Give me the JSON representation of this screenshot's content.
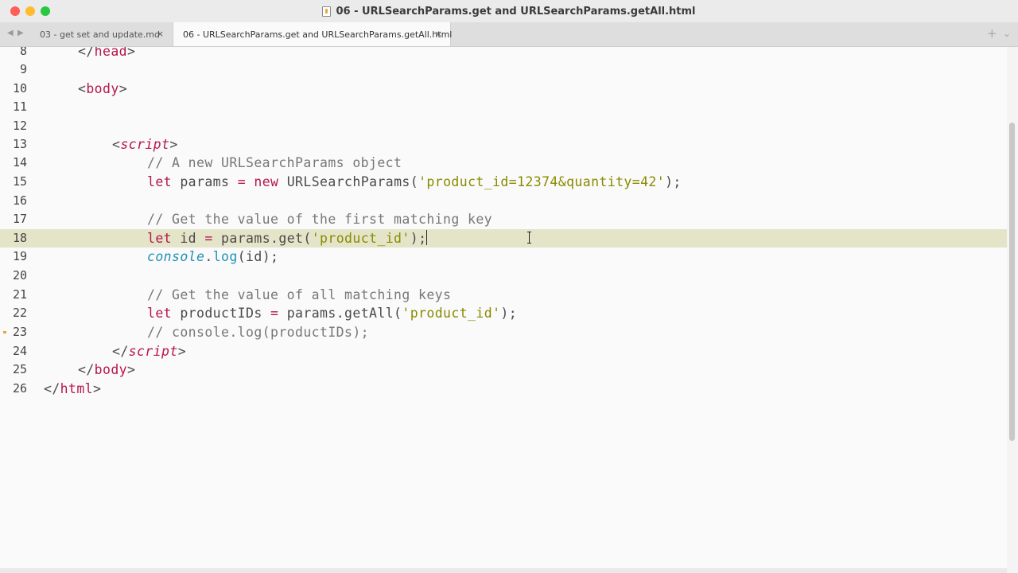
{
  "window": {
    "title": "06 - URLSearchParams.get and URLSearchParams.getAll.html"
  },
  "tabs": [
    {
      "label": "03 - get set and update.md",
      "active": false
    },
    {
      "label": "06 - URLSearchParams.get and URLSearchParams.getAll.html",
      "active": true
    }
  ],
  "icons": {
    "back": "◀",
    "forward": "▶",
    "close": "×",
    "new_tab": "+",
    "tab_overflow": "⌄"
  },
  "editor": {
    "active_line": "18",
    "modified_line": "23",
    "lines": [
      {
        "num": "8",
        "tokens": [
          "</",
          "head",
          ">"
        ]
      },
      {
        "num": "9",
        "tokens": []
      },
      {
        "num": "10",
        "tokens": [
          "<",
          "body",
          ">"
        ]
      },
      {
        "num": "11",
        "tokens": []
      },
      {
        "num": "12",
        "tokens": []
      },
      {
        "num": "13",
        "tokens": [
          "<",
          "script",
          ">"
        ]
      },
      {
        "num": "14",
        "tokens": [
          "// A new URLSearchParams object"
        ]
      },
      {
        "num": "15",
        "tokens": [
          "let",
          " params ",
          "=",
          " ",
          "new",
          " URLSearchParams(",
          "'product_id=12374&quantity=42'",
          ");"
        ]
      },
      {
        "num": "16",
        "tokens": []
      },
      {
        "num": "17",
        "tokens": [
          "// Get the value of the first matching key"
        ]
      },
      {
        "num": "18",
        "tokens": [
          "let",
          " id ",
          "=",
          " params.get(",
          "'product_id'",
          ");"
        ]
      },
      {
        "num": "19",
        "tokens": [
          "console",
          ".",
          "log",
          "(id);"
        ]
      },
      {
        "num": "20",
        "tokens": []
      },
      {
        "num": "21",
        "tokens": [
          "// Get the value of all matching keys"
        ]
      },
      {
        "num": "22",
        "tokens": [
          "let",
          " productIDs ",
          "=",
          " params.getAll(",
          "'product_id'",
          ");"
        ]
      },
      {
        "num": "23",
        "tokens": [
          "// console.log(productIDs);"
        ]
      },
      {
        "num": "24",
        "tokens": [
          "</",
          "script",
          ">"
        ]
      },
      {
        "num": "25",
        "tokens": [
          "</",
          "body",
          ">"
        ]
      },
      {
        "num": "26",
        "tokens": [
          "</",
          "html",
          ">"
        ]
      }
    ]
  },
  "colors": {
    "tag": "#b5174a",
    "keyword": "#b5174a",
    "string": "#8a8a00",
    "comment": "#777777",
    "builtin": "#2091b6",
    "active_line": "#e4e4c8"
  }
}
